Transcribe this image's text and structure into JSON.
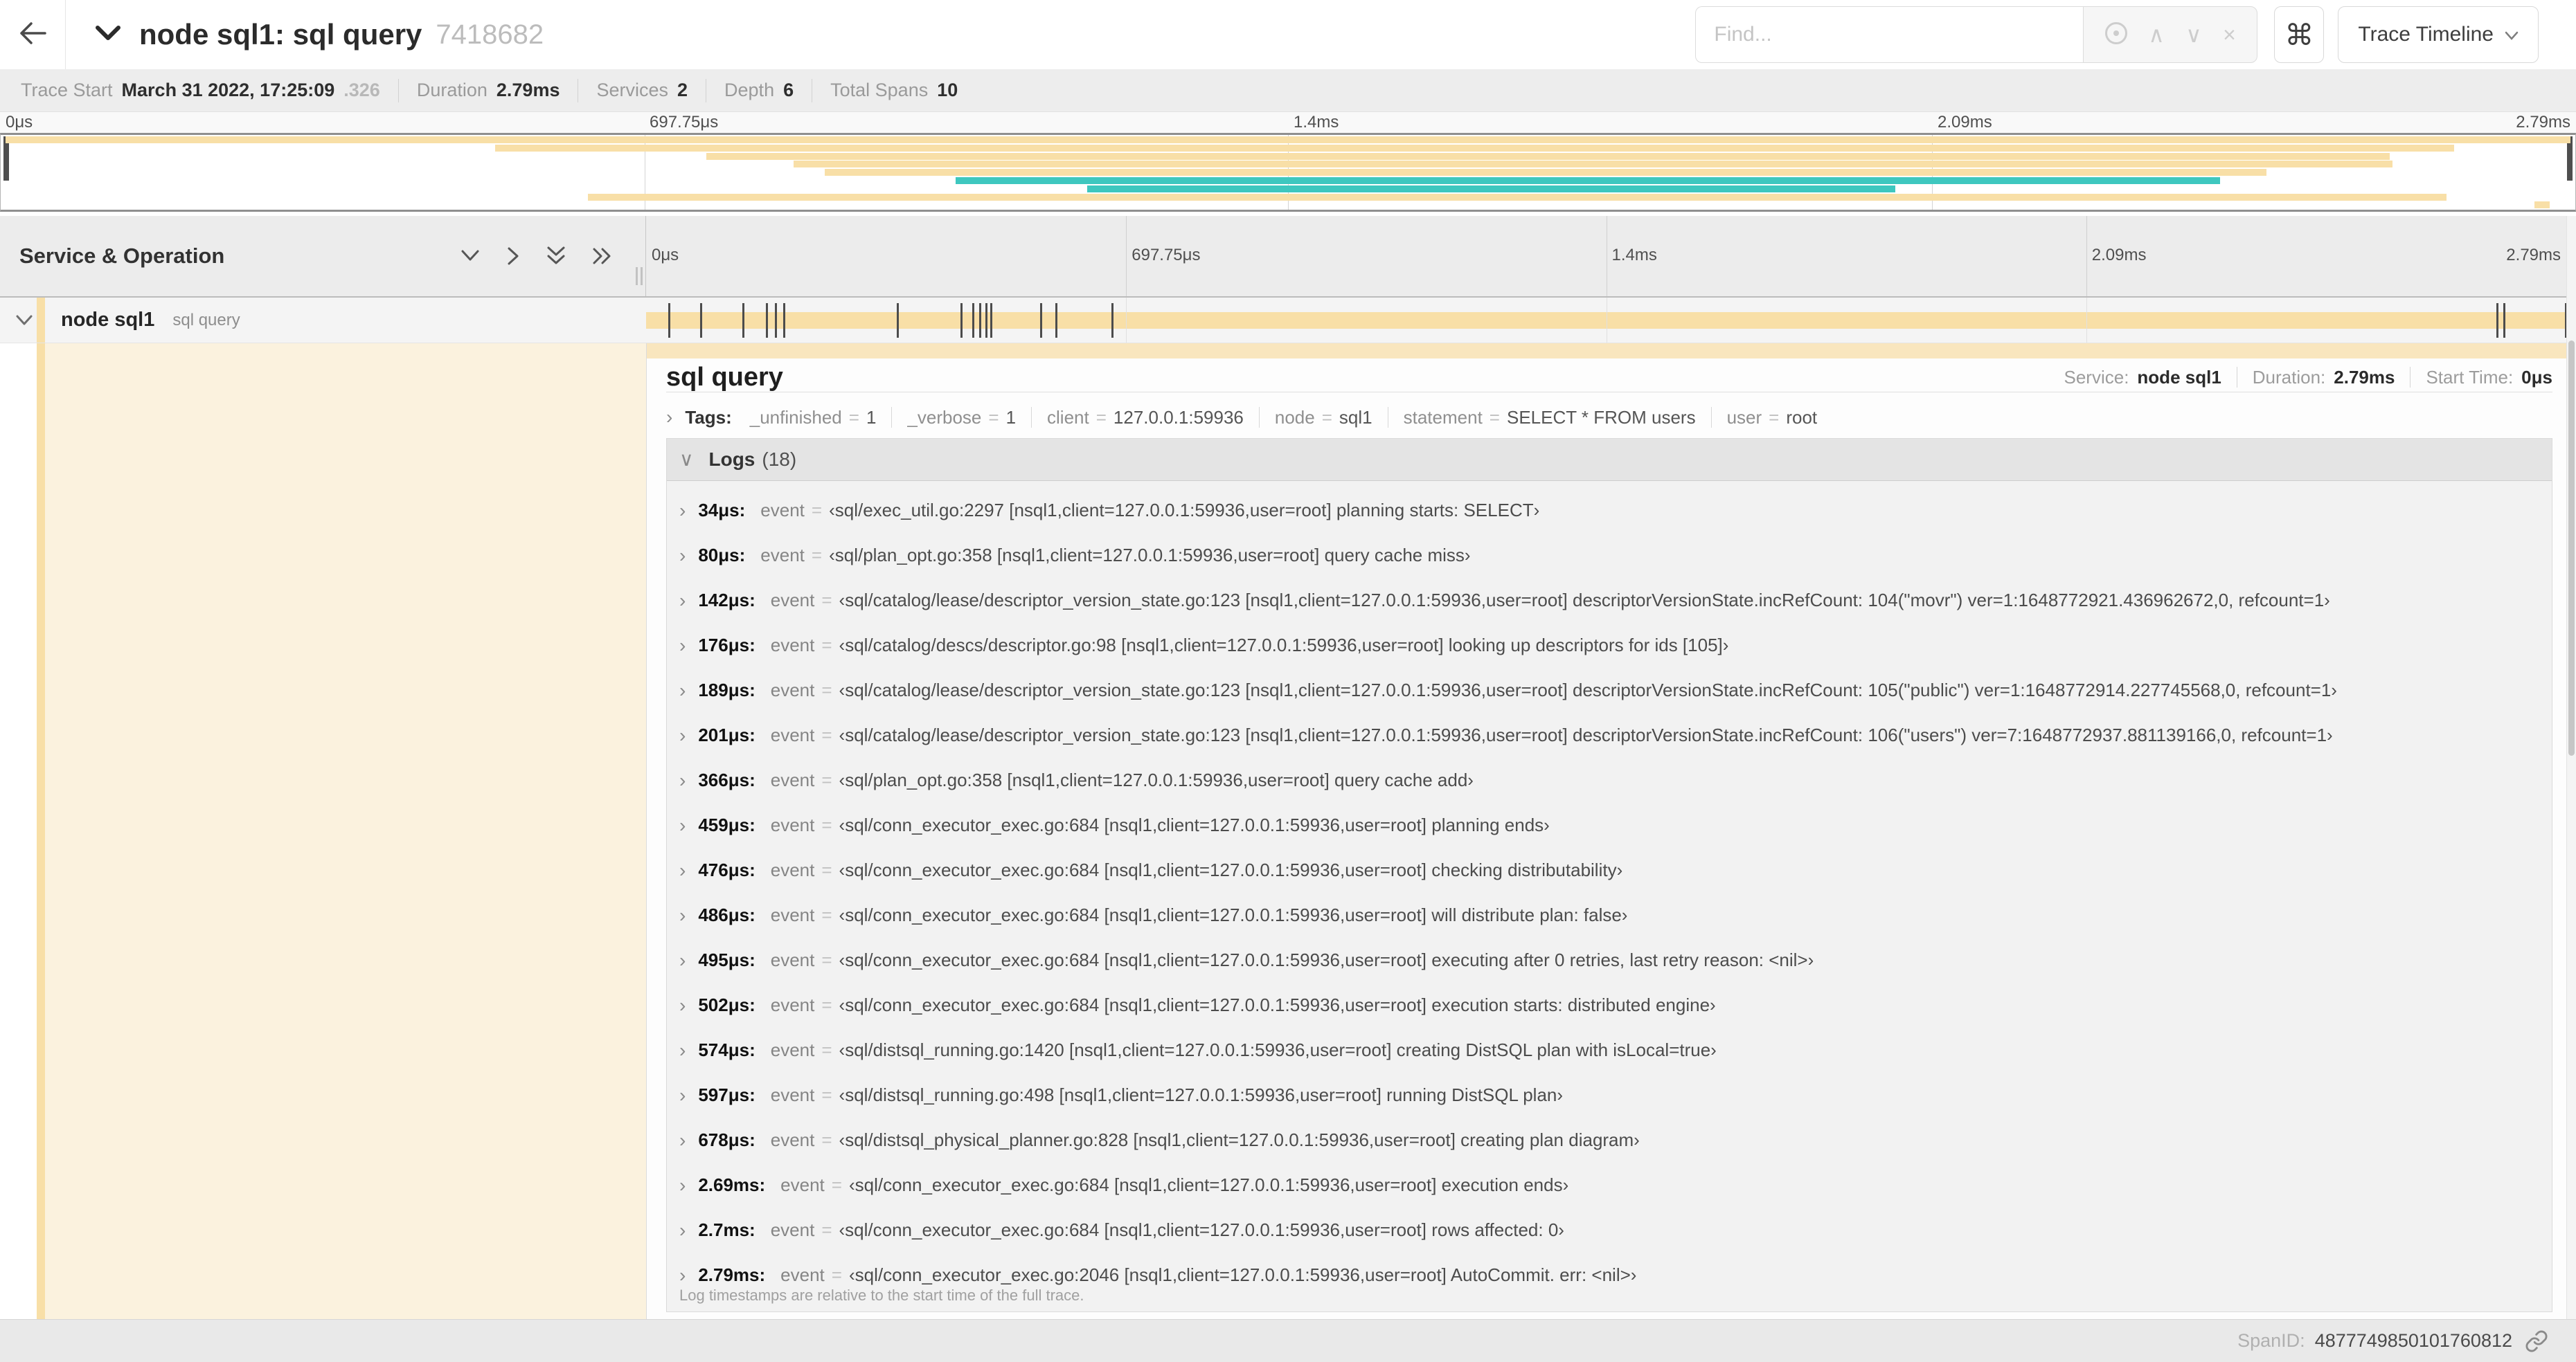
{
  "colors": {
    "tan": "#F8DFA7",
    "tan_light": "#F9E6BE",
    "teal": "#3EC7BF",
    "cream": "#FBF2DE"
  },
  "header": {
    "title": "node sql1: sql query",
    "trace_id_short": "7418682",
    "find_placeholder": "Find...",
    "shortcut_key": "⌘",
    "view_dropdown": "Trace Timeline"
  },
  "summary": {
    "items": [
      {
        "label": "Trace Start",
        "value": "March 31 2022, 17:25:09",
        "suffix": ".326"
      },
      {
        "label": "Duration",
        "value": "2.79ms"
      },
      {
        "label": "Services",
        "value": "2"
      },
      {
        "label": "Depth",
        "value": "6"
      },
      {
        "label": "Total Spans",
        "value": "10"
      }
    ]
  },
  "ruler": {
    "ticks": [
      {
        "label": "0μs",
        "pct": 0
      },
      {
        "label": "697.75μs",
        "pct": 25
      },
      {
        "label": "1.4ms",
        "pct": 50
      },
      {
        "label": "2.09ms",
        "pct": 75
      },
      {
        "label": "2.79ms",
        "pct": 100
      }
    ]
  },
  "minimap": {
    "rows": [
      {
        "color": "tan",
        "start": 0.2,
        "end": 99.8
      },
      {
        "color": "tan",
        "start": 19.2,
        "end": 95.3
      },
      {
        "color": "tan",
        "start": 27.4,
        "end": 92.8
      },
      {
        "color": "tan",
        "start": 30.8,
        "end": 92.9
      },
      {
        "color": "tan",
        "start": 32.0,
        "end": 88.0
      },
      {
        "color": "teal",
        "start": 37.1,
        "end": 86.2
      },
      {
        "color": "teal",
        "start": 42.2,
        "end": 73.6
      },
      {
        "color": "tan",
        "start": 22.8,
        "end": 95.0
      },
      {
        "color": "tan",
        "start": 98.4,
        "end": 99.0
      }
    ]
  },
  "timeline_header": {
    "title": "Service & Operation"
  },
  "span_row": {
    "service": "node sql1",
    "operation": "sql query"
  },
  "trace_duration_us": 2790,
  "detail": {
    "title": "sql query",
    "meta": [
      {
        "label": "Service:",
        "value": "node sql1"
      },
      {
        "label": "Duration:",
        "value": "2.79ms"
      },
      {
        "label": "Start Time:",
        "value": "0μs"
      }
    ],
    "tags_label": "Tags:",
    "tags": [
      {
        "key": "_unfinished",
        "value": "1"
      },
      {
        "key": "_verbose",
        "value": "1"
      },
      {
        "key": "client",
        "value": "127.0.0.1:59936"
      },
      {
        "key": "node",
        "value": "sql1"
      },
      {
        "key": "statement",
        "value": "SELECT * FROM users"
      },
      {
        "key": "user",
        "value": "root"
      }
    ],
    "logs_label": "Logs",
    "logs_count": "(18)",
    "logs": [
      {
        "time": "34μs:",
        "time_us": 34,
        "key": "event",
        "value": "‹sql/exec_util.go:2297 [nsql1,client=127.0.0.1:59936,user=root] planning starts: SELECT›"
      },
      {
        "time": "80μs:",
        "time_us": 80,
        "key": "event",
        "value": "‹sql/plan_opt.go:358 [nsql1,client=127.0.0.1:59936,user=root] query cache miss›"
      },
      {
        "time": "142μs:",
        "time_us": 142,
        "key": "event",
        "value": "‹sql/catalog/lease/descriptor_version_state.go:123 [nsql1,client=127.0.0.1:59936,user=root] descriptorVersionState.incRefCount: 104(\"movr\") ver=1:1648772921.436962672,0, refcount=1›"
      },
      {
        "time": "176μs:",
        "time_us": 176,
        "key": "event",
        "value": "‹sql/catalog/descs/descriptor.go:98 [nsql1,client=127.0.0.1:59936,user=root] looking up descriptors for ids [105]›"
      },
      {
        "time": "189μs:",
        "time_us": 189,
        "key": "event",
        "value": "‹sql/catalog/lease/descriptor_version_state.go:123 [nsql1,client=127.0.0.1:59936,user=root] descriptorVersionState.incRefCount: 105(\"public\") ver=1:1648772914.227745568,0, refcount=1›"
      },
      {
        "time": "201μs:",
        "time_us": 201,
        "key": "event",
        "value": "‹sql/catalog/lease/descriptor_version_state.go:123 [nsql1,client=127.0.0.1:59936,user=root] descriptorVersionState.incRefCount: 106(\"users\") ver=7:1648772937.881139166,0, refcount=1›"
      },
      {
        "time": "366μs:",
        "time_us": 366,
        "key": "event",
        "value": "‹sql/plan_opt.go:358 [nsql1,client=127.0.0.1:59936,user=root] query cache add›"
      },
      {
        "time": "459μs:",
        "time_us": 459,
        "key": "event",
        "value": "‹sql/conn_executor_exec.go:684 [nsql1,client=127.0.0.1:59936,user=root] planning ends›"
      },
      {
        "time": "476μs:",
        "time_us": 476,
        "key": "event",
        "value": "‹sql/conn_executor_exec.go:684 [nsql1,client=127.0.0.1:59936,user=root] checking distributability›"
      },
      {
        "time": "486μs:",
        "time_us": 486,
        "key": "event",
        "value": "‹sql/conn_executor_exec.go:684 [nsql1,client=127.0.0.1:59936,user=root] will distribute plan: false›"
      },
      {
        "time": "495μs:",
        "time_us": 495,
        "key": "event",
        "value": "‹sql/conn_executor_exec.go:684 [nsql1,client=127.0.0.1:59936,user=root] executing after 0 retries, last retry reason: <nil>›"
      },
      {
        "time": "502μs:",
        "time_us": 502,
        "key": "event",
        "value": "‹sql/conn_executor_exec.go:684 [nsql1,client=127.0.0.1:59936,user=root] execution starts: distributed engine›"
      },
      {
        "time": "574μs:",
        "time_us": 574,
        "key": "event",
        "value": "‹sql/distsql_running.go:1420 [nsql1,client=127.0.0.1:59936,user=root] creating DistSQL plan with isLocal=true›"
      },
      {
        "time": "597μs:",
        "time_us": 597,
        "key": "event",
        "value": "‹sql/distsql_running.go:498 [nsql1,client=127.0.0.1:59936,user=root] running DistSQL plan›"
      },
      {
        "time": "678μs:",
        "time_us": 678,
        "key": "event",
        "value": "‹sql/distsql_physical_planner.go:828 [nsql1,client=127.0.0.1:59936,user=root] creating plan diagram›"
      },
      {
        "time": "2.69ms:",
        "time_us": 2690,
        "key": "event",
        "value": "‹sql/conn_executor_exec.go:684 [nsql1,client=127.0.0.1:59936,user=root] execution ends›"
      },
      {
        "time": "2.7ms:",
        "time_us": 2700,
        "key": "event",
        "value": "‹sql/conn_executor_exec.go:684 [nsql1,client=127.0.0.1:59936,user=root] rows affected: 0›"
      },
      {
        "time": "2.79ms:",
        "time_us": 2790,
        "key": "event",
        "value": "‹sql/conn_executor_exec.go:2046 [nsql1,client=127.0.0.1:59936,user=root] AutoCommit. err: <nil>›"
      }
    ],
    "logs_footer": "Log timestamps are relative to the start time of the full trace.",
    "span_id_label": "SpanID:",
    "span_id": "4877749850101760812"
  }
}
